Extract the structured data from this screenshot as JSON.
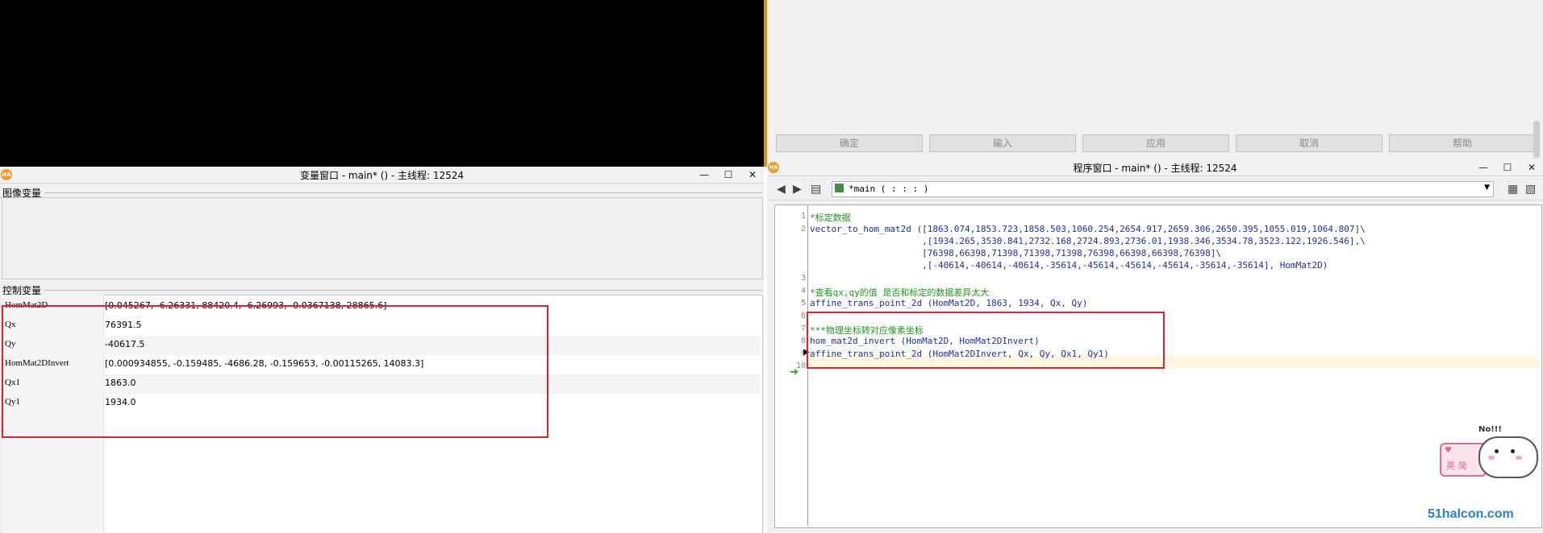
{
  "variable_window": {
    "title": "变量窗口 - main* () - 主线程: 12524",
    "image_vars_label": "图像变量",
    "control_vars_label": "控制变量",
    "rows": [
      {
        "name": "HomMat2D",
        "value": "[0.045267, -6.26331, 88420.4, -6.26993, -0.0367138, 28865.6]"
      },
      {
        "name": "Qx",
        "value": "76391.5"
      },
      {
        "name": "Qy",
        "value": "-40617.5"
      },
      {
        "name": "HomMat2DInvert",
        "value": "[0.000934855, -0.159485, -4686.28, -0.159653, -0.00115265, 14083.3]"
      },
      {
        "name": "Qx1",
        "value": "1863.0"
      },
      {
        "name": "Qy1",
        "value": "1934.0"
      }
    ]
  },
  "dialog": {
    "buttons": [
      "确定",
      "输入",
      "应用",
      "取消",
      "帮助"
    ]
  },
  "program_window": {
    "title": "程序窗口 - main* () - 主线程: 12524",
    "procedure": "*main ( : : : )",
    "lines": [
      {
        "n": "1",
        "text": "*标定数据",
        "comment": true
      },
      {
        "n": "2",
        "text": "vector_to_hom_mat2d ([1863.074,1853.723,1858.503,1060.254,2654.917,2659.306,2650.395,1055.019,1064.807]\\",
        "comment": false
      },
      {
        "n": "",
        "text": "                     ,[1934.265,3530.841,2732.168,2724.893,2736.01,1938.346,3534.78,3523.122,1926.546],\\",
        "comment": false
      },
      {
        "n": "",
        "text": "                     [76398,66398,71398,71398,71398,76398,66398,66398,76398]\\",
        "comment": false
      },
      {
        "n": "",
        "text": "                     ,[-40614,-40614,-40614,-35614,-45614,-45614,-45614,-35614,-35614], HomMat2D)",
        "comment": false
      },
      {
        "n": "3",
        "text": "",
        "comment": false
      },
      {
        "n": "4",
        "text": "*查看qx,qy的值 是否和标定的数据差异太大",
        "comment": true
      },
      {
        "n": "5",
        "text": "affine_trans_point_2d (HomMat2D, 1863, 1934, Qx, Qy)",
        "comment": false
      },
      {
        "n": "6",
        "text": "",
        "comment": false
      },
      {
        "n": "7",
        "text": "***物理坐标转对应像素坐标",
        "comment": true
      },
      {
        "n": "8",
        "text": "hom_mat2d_invert (HomMat2D, HomMat2DInvert)",
        "comment": false
      },
      {
        "n": "9",
        "text": "affine_trans_point_2d (HomMat2DInvert, Qx, Qy, Qx1, Qy1)",
        "comment": false
      },
      {
        "n": "10",
        "text": "",
        "comment": false
      }
    ]
  },
  "sticker": {
    "caption": "No!!!",
    "label": "英 简"
  },
  "watermark": "51halcon.com",
  "colors": {
    "accent": "#e0901c",
    "highlight_box": "#e0202a",
    "code": "#1f2fa8",
    "comment": "#1a9a1a"
  }
}
